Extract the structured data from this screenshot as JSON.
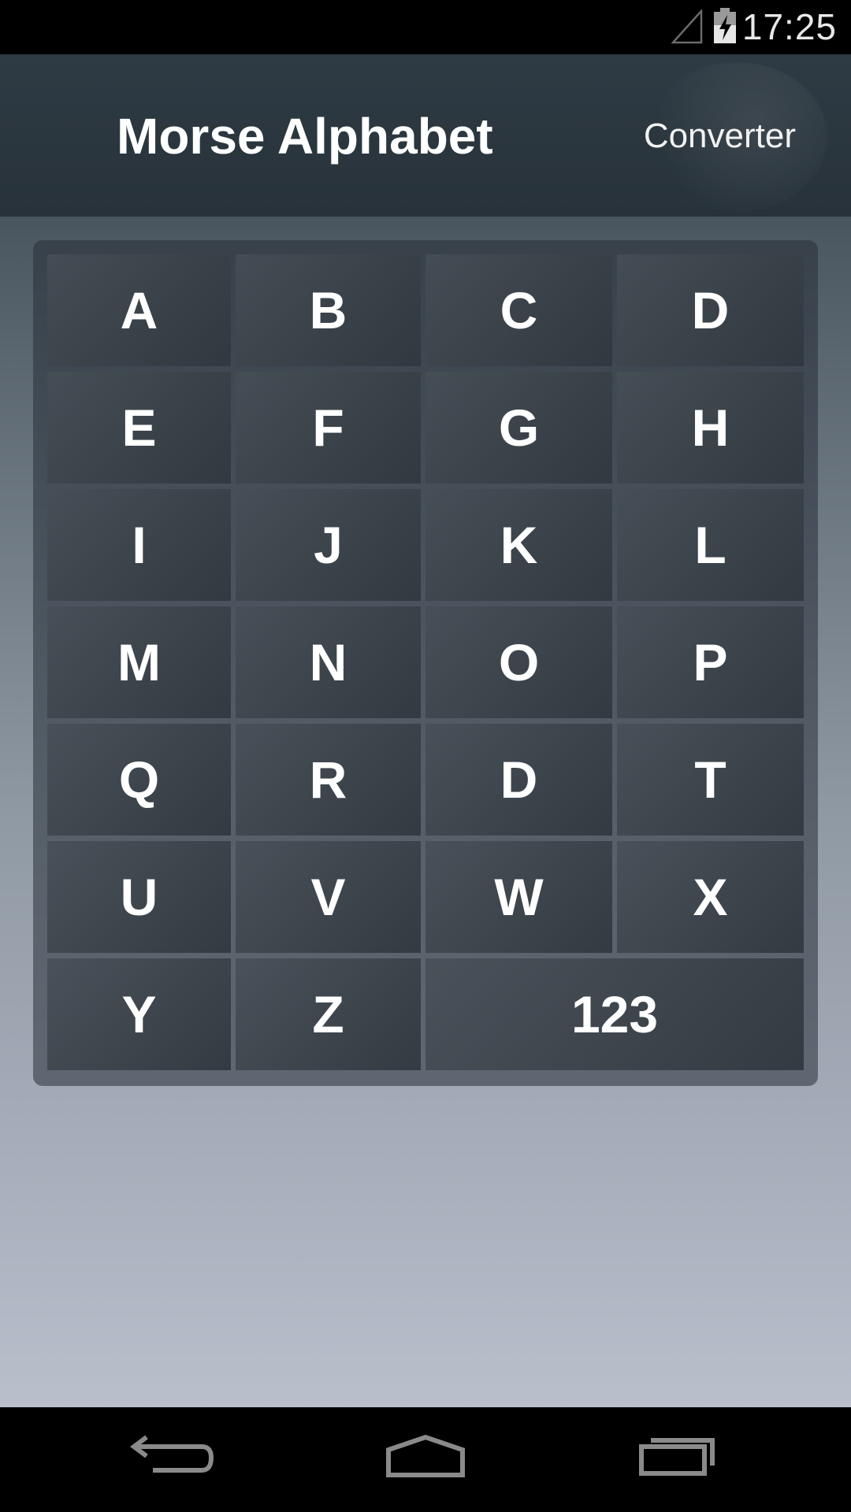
{
  "status_bar": {
    "time": "17:25",
    "icons": [
      "signal-icon",
      "battery-charging-icon"
    ]
  },
  "action_bar": {
    "title": "Morse Alphabet",
    "action_label": "Converter"
  },
  "keys": [
    {
      "label": "A"
    },
    {
      "label": "B"
    },
    {
      "label": "C"
    },
    {
      "label": "D"
    },
    {
      "label": "E"
    },
    {
      "label": "F"
    },
    {
      "label": "G"
    },
    {
      "label": "H"
    },
    {
      "label": "I"
    },
    {
      "label": "J"
    },
    {
      "label": "K"
    },
    {
      "label": "L"
    },
    {
      "label": "M"
    },
    {
      "label": "N"
    },
    {
      "label": "O"
    },
    {
      "label": "P"
    },
    {
      "label": "Q"
    },
    {
      "label": "R"
    },
    {
      "label": "D"
    },
    {
      "label": "T"
    },
    {
      "label": "U"
    },
    {
      "label": "V"
    },
    {
      "label": "W"
    },
    {
      "label": "X"
    },
    {
      "label": "Y"
    },
    {
      "label": "Z"
    },
    {
      "label": "123",
      "wide": true
    }
  ],
  "nav_bar": {
    "icons": [
      "back-icon",
      "home-icon",
      "recents-icon"
    ]
  },
  "colors": {
    "action_bar": "#2b363e",
    "status_bar": "#000000",
    "nav_bar": "#000000",
    "key_text": "#ffffff"
  }
}
